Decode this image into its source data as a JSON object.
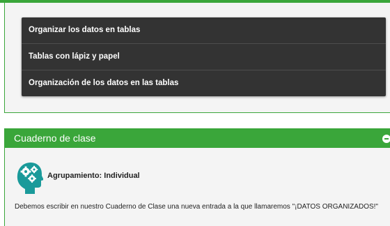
{
  "colors": {
    "accent": "#3aa63a",
    "menu_bg": "#333333",
    "teal_icon": "#1a9a9a"
  },
  "menu": {
    "items": [
      {
        "label": "Organizar los datos en tablas"
      },
      {
        "label": "Tablas con lápiz y papel"
      },
      {
        "label": "Organización de los datos en las tablas"
      }
    ]
  },
  "notebook": {
    "title": "Cuaderno de clase",
    "icon": "head-gears-icon",
    "collapse_icon": "minus-circle-icon",
    "grouping": "Agrupamiento: Individual",
    "text": "Debemos escribir en nuestro Cuaderno de Clase una nueva entrada a la  que llamaremos \"¡DATOS ORGANIZADOS!\""
  }
}
